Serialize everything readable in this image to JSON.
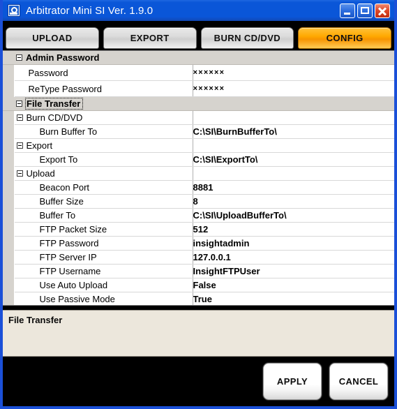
{
  "window": {
    "title": "Arbitrator Mini SI Ver. 1.9.0",
    "icon": "app-icon",
    "controls": {
      "minimize": "minimize-icon",
      "maximize": "maximize-icon",
      "close": "close-icon"
    },
    "accent_color": "#0a56d8",
    "active_tab_color": "#ffa800"
  },
  "tabs": [
    {
      "label": "UPLOAD",
      "active": false
    },
    {
      "label": "EXPORT",
      "active": false
    },
    {
      "label": "BURN CD/DVD",
      "active": false
    },
    {
      "label": "CONFIG",
      "active": true
    }
  ],
  "grid": {
    "rows": [
      {
        "type": "category",
        "name": "Admin Password",
        "value": "",
        "expanded": true,
        "focused": false
      },
      {
        "type": "property",
        "name": "Password",
        "value": "××××××",
        "indent": 1
      },
      {
        "type": "property",
        "name": "ReType Password",
        "value": "××××××",
        "indent": 1
      },
      {
        "type": "category",
        "name": "File Transfer",
        "value": "",
        "expanded": true,
        "focused": true
      },
      {
        "type": "subcategory",
        "name": "Burn CD/DVD",
        "value": "",
        "expanded": true,
        "indent": 1
      },
      {
        "type": "property",
        "name": "Burn Buffer To",
        "value": "C:\\SI\\BurnBufferTo\\",
        "indent": 2
      },
      {
        "type": "subcategory",
        "name": "Export",
        "value": "",
        "expanded": true,
        "indent": 1
      },
      {
        "type": "property",
        "name": "Export To",
        "value": "C:\\SI\\ExportTo\\",
        "indent": 2
      },
      {
        "type": "subcategory",
        "name": "Upload",
        "value": "",
        "expanded": true,
        "indent": 1
      },
      {
        "type": "property",
        "name": "Beacon Port",
        "value": "8881",
        "indent": 2
      },
      {
        "type": "property",
        "name": "Buffer Size",
        "value": "8",
        "indent": 2
      },
      {
        "type": "property",
        "name": "Buffer To",
        "value": "C:\\SI\\UploadBufferTo\\",
        "indent": 2
      },
      {
        "type": "property",
        "name": "FTP Packet Size",
        "value": "512",
        "indent": 2
      },
      {
        "type": "property",
        "name": "FTP Password",
        "value": "insightadmin",
        "indent": 2
      },
      {
        "type": "property",
        "name": "FTP Server IP",
        "value": "127.0.0.1",
        "indent": 2
      },
      {
        "type": "property",
        "name": "FTP Username",
        "value": "InsightFTPUser",
        "indent": 2
      },
      {
        "type": "property",
        "name": "Use Auto Upload",
        "value": "False",
        "indent": 2
      },
      {
        "type": "property",
        "name": "Use Passive Mode",
        "value": "True",
        "indent": 2
      }
    ]
  },
  "description": {
    "text": "File Transfer"
  },
  "footer": {
    "apply_label": "APPLY",
    "cancel_label": "CANCEL"
  }
}
